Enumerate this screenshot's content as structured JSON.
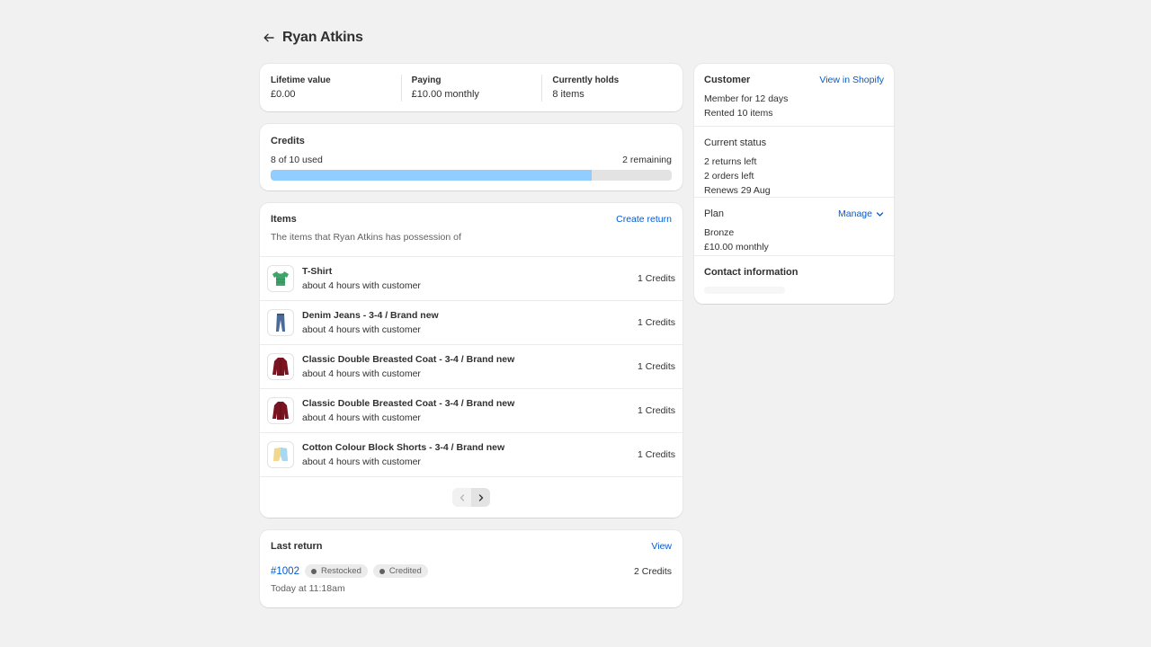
{
  "header": {
    "title": "Ryan Atkins"
  },
  "stats": [
    {
      "label": "Lifetime value",
      "value": "£0.00"
    },
    {
      "label": "Paying",
      "value": "£10.00 monthly"
    },
    {
      "label": "Currently holds",
      "value": "8 items"
    }
  ],
  "credits": {
    "title": "Credits",
    "used_text": "8 of 10 used",
    "remaining_text": "2 remaining",
    "progress": 0.8
  },
  "items": {
    "title": "Items",
    "create_return": "Create return",
    "subtitle": "The items that Ryan Atkins has possession of",
    "list": [
      {
        "name": "T-Shirt",
        "sub": "about 4 hours with customer",
        "credits": "1 Credits",
        "icon": "tshirt"
      },
      {
        "name": "Denim Jeans - 3-4 / Brand new",
        "sub": "about 4 hours with customer",
        "credits": "1 Credits",
        "icon": "jeans"
      },
      {
        "name": "Classic Double Breasted Coat - 3-4 / Brand new",
        "sub": "about 4 hours with customer",
        "credits": "1 Credits",
        "icon": "coat"
      },
      {
        "name": "Classic Double Breasted Coat - 3-4 / Brand new",
        "sub": "about 4 hours with customer",
        "credits": "1 Credits",
        "icon": "coat"
      },
      {
        "name": "Cotton Colour Block Shorts - 3-4 / Brand new",
        "sub": "about 4 hours with customer",
        "credits": "1 Credits",
        "icon": "shorts"
      }
    ]
  },
  "last_return": {
    "title": "Last return",
    "view": "View",
    "order": "#1002",
    "badges": [
      "Restocked",
      "Credited"
    ],
    "credits": "2 Credits",
    "time": "Today at 11:18am"
  },
  "customer": {
    "title": "Customer",
    "view_in_shopify": "View in Shopify",
    "member": "Member for 12 days",
    "rented": "Rented 10 items",
    "status_title": "Current status",
    "returns_left": "2 returns left",
    "orders_left": "2 orders left",
    "renews": "Renews 29 Aug",
    "plan_title": "Plan",
    "manage": "Manage",
    "plan_name": "Bronze",
    "plan_price": "£10.00 monthly",
    "contact_title": "Contact information"
  },
  "colors": {
    "accent": "#005bd3",
    "progress": "#91ceff",
    "background": "#f1f1f1"
  }
}
